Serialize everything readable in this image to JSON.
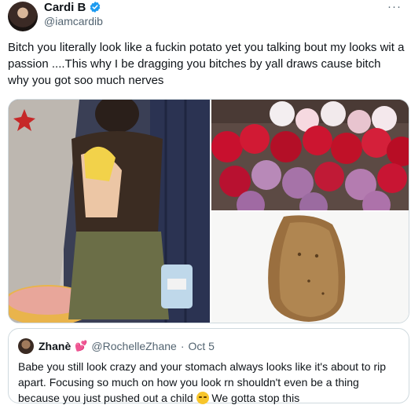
{
  "author": {
    "name": "Cardi B",
    "handle": "@iamcardib",
    "verified_color": "#1d9bf0"
  },
  "more_label": "···",
  "tweet": {
    "text": "Bitch you literally look like a fuckin potato yet you talking bout my looks wit a passion ....This why I be dragging you bitches by yall draws cause bitch why you got soo much nerves"
  },
  "media": {
    "images": [
      "woman-in-brown-tshirt-and-olive-skirt",
      "bouquet-of-red-and-pink-roses",
      "potato"
    ]
  },
  "quote": {
    "name": "Zhanè",
    "heart": "💕",
    "handle": "@RochelleZhane",
    "dot": "·",
    "date": "Oct 5",
    "text_before_emoji": "Babe you still look crazy and your stomach always looks like it's about to rip apart. Focusing so much on how you look rn shouldn't even be a thing because you just pushed out a child ",
    "text_after_emoji": " We gotta stop this x.com/iamcardib/stat..."
  }
}
